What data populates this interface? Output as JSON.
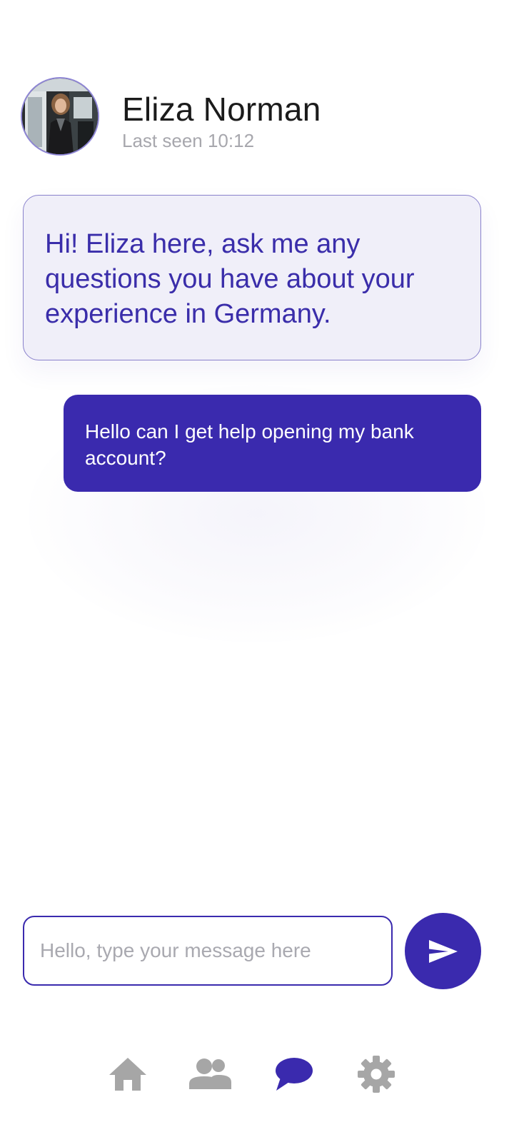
{
  "colors": {
    "primary": "#3a2aae",
    "bubble_in_bg": "#f0eff9",
    "nav_inactive": "#a6a6a6",
    "nav_active": "#3a2aae"
  },
  "contact": {
    "name": "Eliza Norman",
    "status": "Last seen 10:12"
  },
  "messages": [
    {
      "from": "contact",
      "text": "Hi! Eliza here, ask me any questions you have about your experience in Germany."
    },
    {
      "from": "user",
      "text": "Hello can I get help opening my bank account?"
    }
  ],
  "composer": {
    "placeholder": "Hello, type your message here",
    "send_icon": "send-icon"
  },
  "nav": {
    "items": [
      {
        "icon": "home-icon",
        "active": false
      },
      {
        "icon": "people-icon",
        "active": false
      },
      {
        "icon": "chat-icon",
        "active": true
      },
      {
        "icon": "gear-icon",
        "active": false
      }
    ]
  }
}
